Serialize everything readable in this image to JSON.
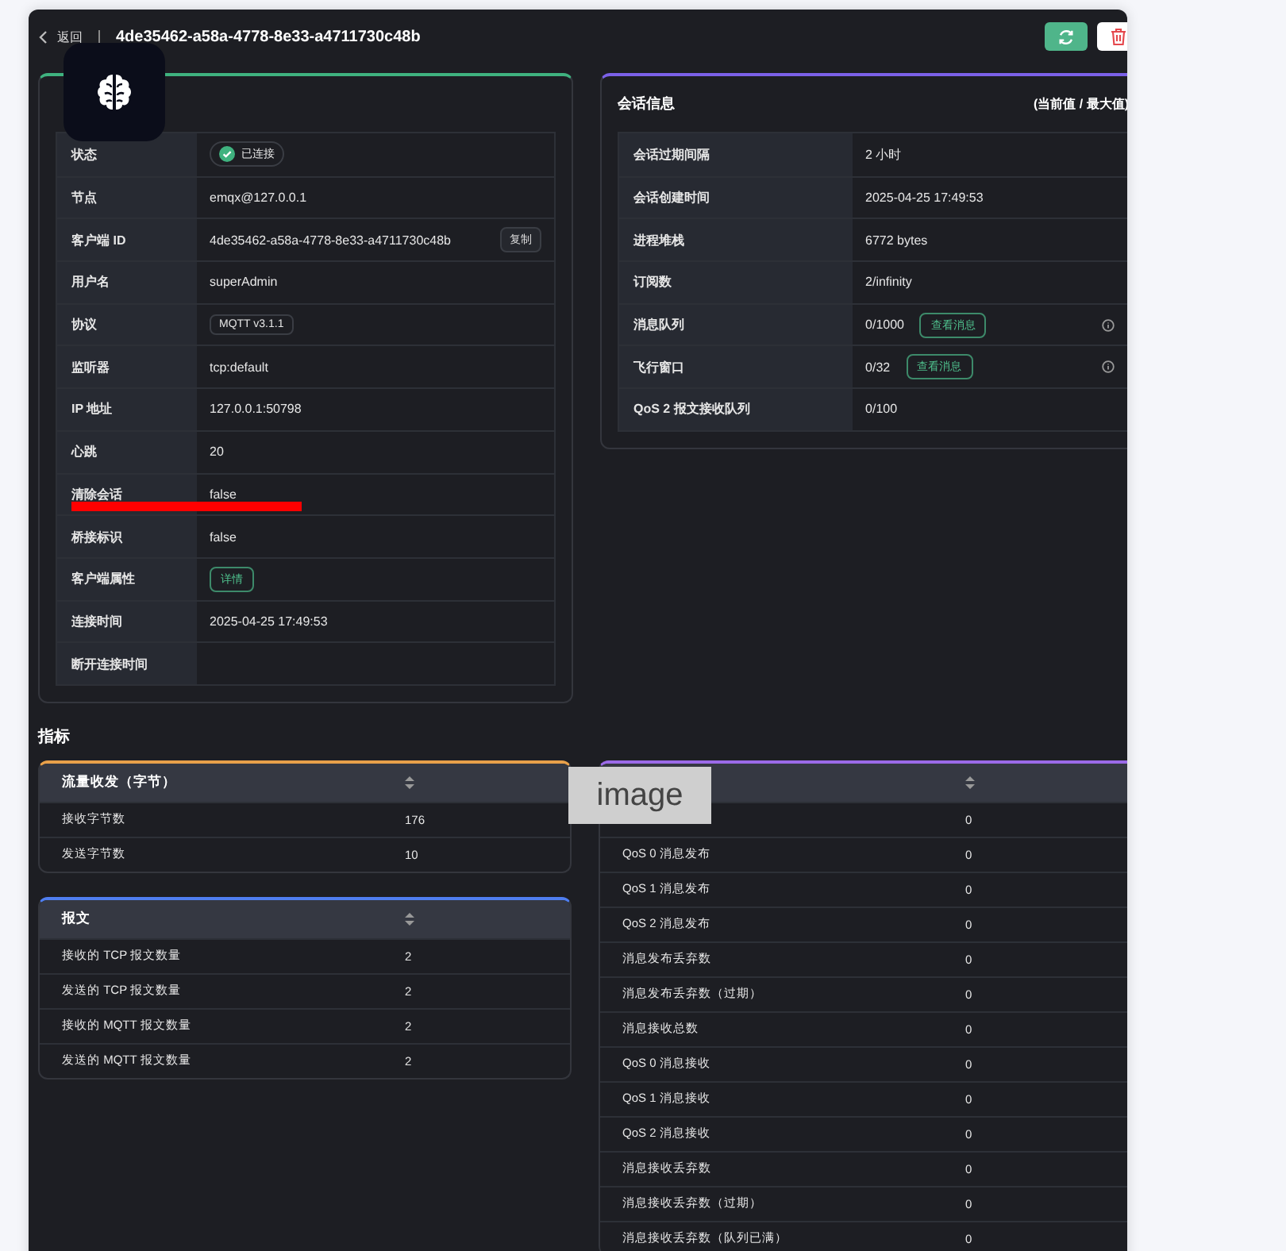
{
  "header": {
    "back_label": "返回",
    "title": "4de35462-a58a-4778-8e33-a4711730c48b"
  },
  "connection": {
    "color": "#3fb27f",
    "rows": [
      {
        "label": "状态",
        "kind": "status",
        "value": "已连接",
        "connected": true
      },
      {
        "label": "节点",
        "kind": "text",
        "value": "emqx@127.0.0.1"
      },
      {
        "label": "客户端 ID",
        "kind": "copy",
        "value": "4de35462-a58a-4778-8e33-a4711730c48b",
        "action": "复制"
      },
      {
        "label": "用户名",
        "kind": "text",
        "value": "superAdmin"
      },
      {
        "label": "协议",
        "kind": "tag",
        "value": "MQTT v3.1.1"
      },
      {
        "label": "监听器",
        "kind": "text",
        "value": "tcp:default"
      },
      {
        "label": "IP 地址",
        "kind": "text",
        "value": "127.0.0.1:50798"
      },
      {
        "label": "心跳",
        "kind": "text",
        "value": "20"
      },
      {
        "label": "清除会话",
        "kind": "text",
        "value": "false"
      },
      {
        "label": "桥接标识",
        "kind": "text",
        "value": "false"
      },
      {
        "label": "客户端属性",
        "kind": "link",
        "value": "详情"
      },
      {
        "label": "连接时间",
        "kind": "text",
        "value": "2025-04-25 17:49:53"
      },
      {
        "label": "断开连接时间",
        "kind": "text"
      }
    ]
  },
  "session": {
    "title": "会话信息",
    "note": "(当前值 / 最大值)",
    "color": "#7b61e8",
    "rows": [
      {
        "label": "会话过期间隔",
        "value": "2 小时"
      },
      {
        "label": "会话创建时间",
        "value": "2025-04-25 17:49:53"
      },
      {
        "label": "进程堆栈",
        "value": "6772 bytes"
      },
      {
        "label": "订阅数",
        "value": "2/infinity"
      },
      {
        "label": "消息队列",
        "value": "0/1000",
        "action": "查看消息",
        "info": true
      },
      {
        "label": "飞行窗口",
        "value": "0/32",
        "action": "查看消息",
        "info": true
      },
      {
        "label": "QoS 2 报文接收队列",
        "value": "0/100"
      }
    ]
  },
  "metrics": {
    "title": "指标",
    "panels": [
      {
        "header": "流量收发（字节）",
        "color": "#e8a04a",
        "rows": [
          {
            "label": "接收字节数",
            "value": "176"
          },
          {
            "label": "发送字节数",
            "value": "10"
          }
        ]
      },
      {
        "header": "报文",
        "color": "#4f7ef0",
        "rows": [
          {
            "label": "接收的 TCP 报文数量",
            "value": "2"
          },
          {
            "label": "发送的 TCP 报文数量",
            "value": "2"
          },
          {
            "label": "接收的 MQTT 报文数量",
            "value": "2"
          },
          {
            "label": "发送的 MQTT 报文数量",
            "value": "2"
          }
        ]
      },
      {
        "color": "#9b6ae8",
        "rows": [
          {
            "value": "0"
          },
          {
            "label": "QoS 0 消息发布",
            "value": "0"
          },
          {
            "label": "QoS 1 消息发布",
            "value": "0"
          },
          {
            "label": "QoS 2 消息发布",
            "value": "0"
          },
          {
            "label": "消息发布丢弃数",
            "value": "0"
          },
          {
            "label": "消息发布丢弃数（过期）",
            "value": "0"
          },
          {
            "label": "消息接收总数",
            "value": "0"
          },
          {
            "label": "QoS 0 消息接收",
            "value": "0"
          },
          {
            "label": "QoS 1 消息接收",
            "value": "0"
          },
          {
            "label": "QoS 2 消息接收",
            "value": "0"
          },
          {
            "label": "消息接收丢弃数",
            "value": "0"
          },
          {
            "label": "消息接收丢弃数（过期）",
            "value": "0"
          },
          {
            "label": "消息接收丢弃数（队列已满）",
            "value": "0"
          }
        ]
      }
    ]
  },
  "overlay": {
    "label": "image"
  }
}
